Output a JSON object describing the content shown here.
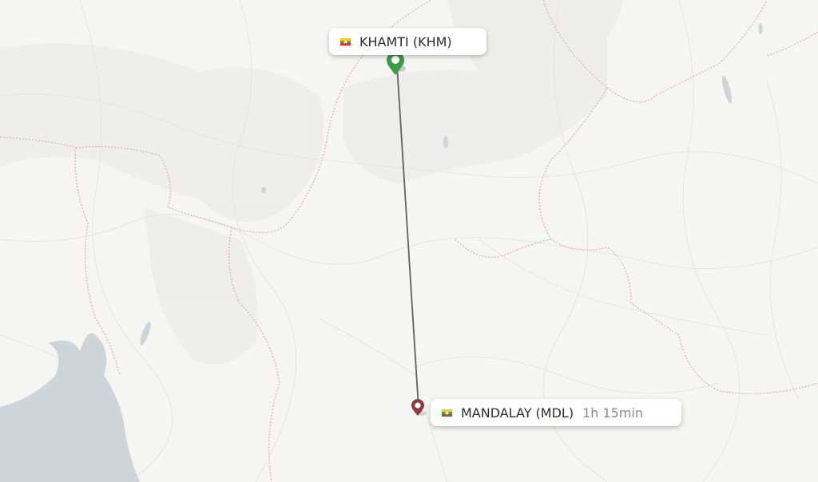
{
  "route": {
    "origin": {
      "name": "KHAMTI (KHM)",
      "flag_icon": "myanmar-flag-icon"
    },
    "destination": {
      "name": "MANDALAY (MDL)",
      "flag_icon": "myanmar-flag-icon",
      "duration": "1h 15min"
    }
  },
  "colors": {
    "land": "#f5f5f4",
    "water": "#cfd4d8",
    "border": "#d6aeb4",
    "road": "#e2e2e2",
    "route_line": "#606060",
    "origin_pin": "#3e9a46",
    "destination_pin": "#8e3a3f"
  }
}
